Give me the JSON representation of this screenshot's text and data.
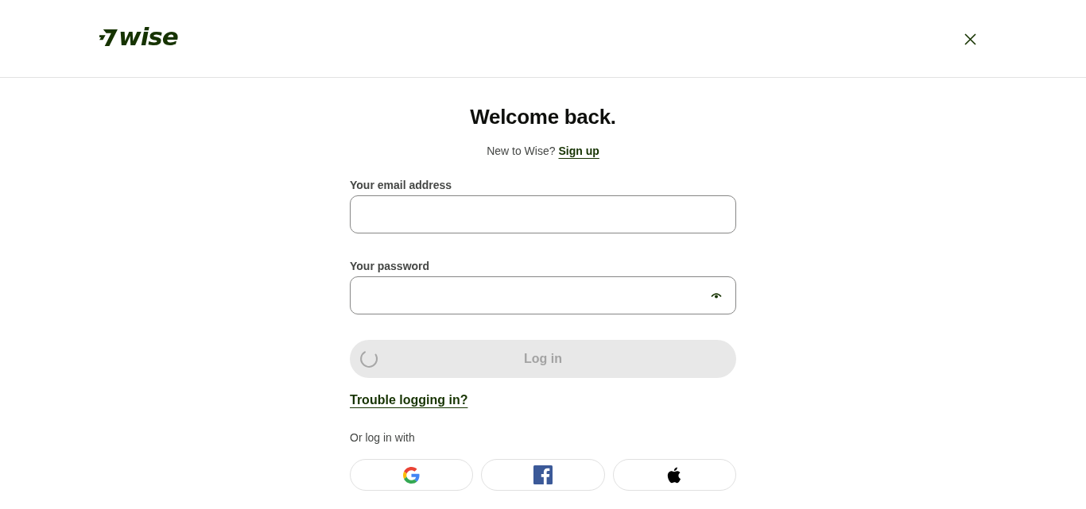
{
  "header": {
    "logo": {
      "text": "wise"
    }
  },
  "title": "Welcome back.",
  "signup": {
    "prompt": "New to Wise?",
    "link": "Sign up"
  },
  "fields": [
    {
      "kind": "email",
      "label": "Your email address"
    },
    {
      "kind": "password",
      "label": "Your password"
    }
  ],
  "login_button": {
    "label": "Log in",
    "disabled": true,
    "loading": true
  },
  "trouble_link": "Trouble logging in?",
  "social": {
    "prompt": "Or log in with",
    "providers": [
      {
        "kind": "google"
      },
      {
        "kind": "facebook"
      },
      {
        "kind": "apple"
      }
    ]
  }
}
